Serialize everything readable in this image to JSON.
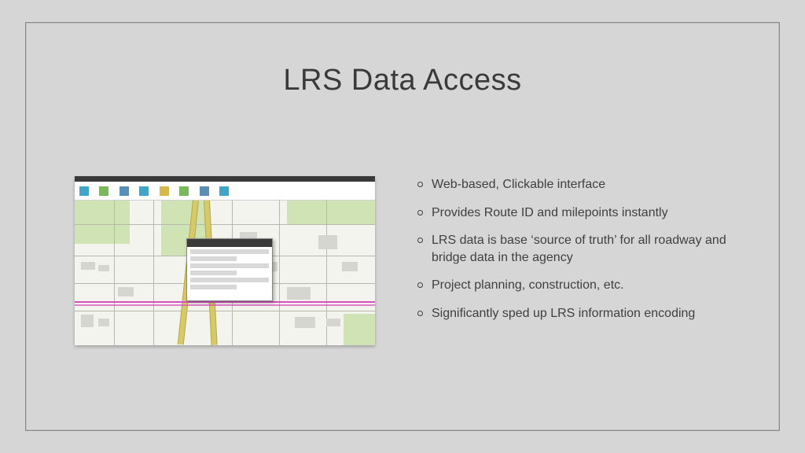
{
  "title": "LRS Data Access",
  "bullets": [
    "Web-based, Clickable interface",
    "Provides Route ID and milepoints instantly",
    "LRS data is base ‘source of truth’ for all roadway and bridge data in the agency",
    "Project planning, construction, etc.",
    "Significantly sped up LRS information encoding"
  ]
}
